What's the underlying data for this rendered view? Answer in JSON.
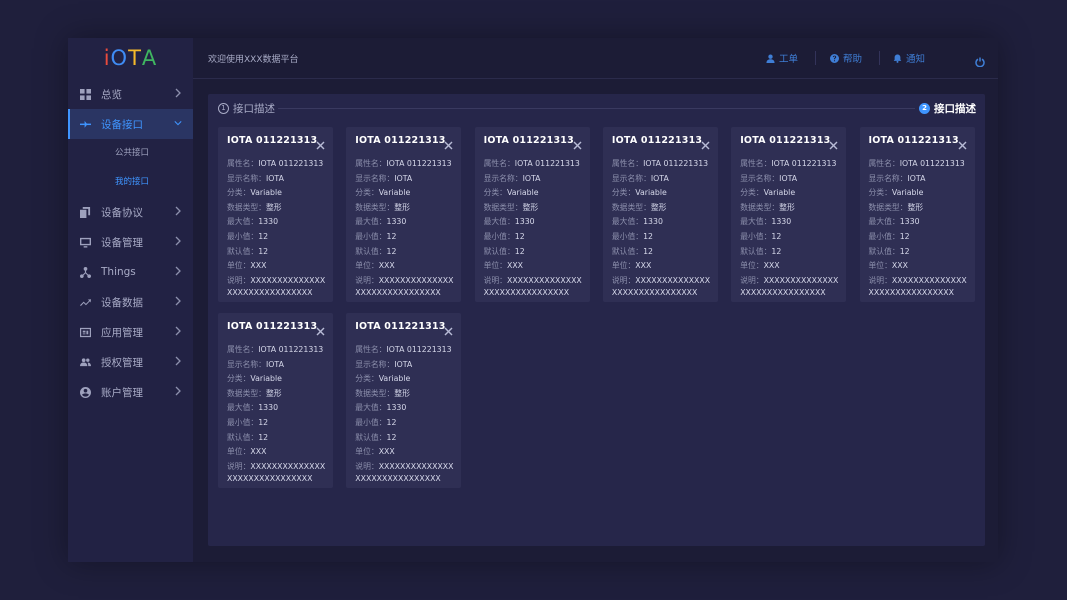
{
  "app": {
    "logo_letters": [
      {
        "ch": "i",
        "color": "#e94b3c"
      },
      {
        "ch": "O",
        "color": "#3f8cf5"
      },
      {
        "ch": "T",
        "color": "#f5b92a"
      },
      {
        "ch": "A",
        "color": "#3fb560"
      }
    ]
  },
  "header": {
    "welcome": "欢迎使用XXX数据平台",
    "worklist": "工单",
    "help": "帮助",
    "notify": "通知"
  },
  "sidebar": {
    "items": [
      {
        "label": "总览",
        "icon": "dashboard-icon"
      },
      {
        "label": "设备接口",
        "icon": "interface-icon",
        "active": true
      },
      {
        "label": "设备协议",
        "icon": "copy-icon"
      },
      {
        "label": "设备管理",
        "icon": "monitor-icon"
      },
      {
        "label": "Things",
        "icon": "network-icon"
      },
      {
        "label": "设备数据",
        "icon": "trend-icon"
      },
      {
        "label": "应用管理",
        "icon": "app-icon"
      },
      {
        "label": "授权管理",
        "icon": "people-icon"
      },
      {
        "label": "账户管理",
        "icon": "account-icon"
      }
    ],
    "submenu": [
      {
        "label": "公共接口"
      },
      {
        "label": "我的接口",
        "active": true
      }
    ]
  },
  "steps": {
    "step1": {
      "num": "1",
      "label": "接口描述"
    },
    "step2": {
      "num": "2",
      "label": "接口描述"
    }
  },
  "labels": {
    "attr_name": "属性名：",
    "display_name": "显示名称：",
    "category": "分类：",
    "data_type": "数据类型：",
    "max": "最大值：",
    "min": "最小值：",
    "default": "默认值：",
    "unit": "单位：",
    "desc": "说明："
  },
  "cards": [
    {
      "title": "IOTA  011221313",
      "attr_name": "IOTA  011221313",
      "display_name": "IOTA",
      "category": "Variable",
      "data_type": "整形",
      "max": "1330",
      "min": "12",
      "default": "12",
      "unit": "XXX",
      "desc": "XXXXXXXXXXXXXXXXXXXXXXXXXXXXXX"
    },
    {
      "title": "IOTA  011221313",
      "attr_name": "IOTA  011221313",
      "display_name": "IOTA",
      "category": "Variable",
      "data_type": "整形",
      "max": "1330",
      "min": "12",
      "default": "12",
      "unit": "XXX",
      "desc": "XXXXXXXXXXXXXXXXXXXXXXXXXXXXXX"
    },
    {
      "title": "IOTA  011221313",
      "attr_name": "IOTA  011221313",
      "display_name": "IOTA",
      "category": "Variable",
      "data_type": "整形",
      "max": "1330",
      "min": "12",
      "default": "12",
      "unit": "XXX",
      "desc": "XXXXXXXXXXXXXXXXXXXXXXXXXXXXXX"
    },
    {
      "title": "IOTA  011221313",
      "attr_name": "IOTA  011221313",
      "display_name": "IOTA",
      "category": "Variable",
      "data_type": "整形",
      "max": "1330",
      "min": "12",
      "default": "12",
      "unit": "XXX",
      "desc": "XXXXXXXXXXXXXXXXXXXXXXXXXXXXXX"
    },
    {
      "title": "IOTA  011221313",
      "attr_name": "IOTA  011221313",
      "display_name": "IOTA",
      "category": "Variable",
      "data_type": "整形",
      "max": "1330",
      "min": "12",
      "default": "12",
      "unit": "XXX",
      "desc": "XXXXXXXXXXXXXXXXXXXXXXXXXXXXXX"
    },
    {
      "title": "IOTA  011221313",
      "attr_name": "IOTA  011221313",
      "display_name": "IOTA",
      "category": "Variable",
      "data_type": "整形",
      "max": "1330",
      "min": "12",
      "default": "12",
      "unit": "XXX",
      "desc": "XXXXXXXXXXXXXXXXXXXXXXXXXXXXXX"
    },
    {
      "title": "IOTA  011221313",
      "attr_name": "IOTA  011221313",
      "display_name": "IOTA",
      "category": "Variable",
      "data_type": "整形",
      "max": "1330",
      "min": "12",
      "default": "12",
      "unit": "XXX",
      "desc": "XXXXXXXXXXXXXXXXXXXXXXXXXXXXXX"
    },
    {
      "title": "IOTA  011221313",
      "attr_name": "IOTA  011221313",
      "display_name": "IOTA",
      "category": "Variable",
      "data_type": "整形",
      "max": "1330",
      "min": "12",
      "default": "12",
      "unit": "XXX",
      "desc": "XXXXXXXXXXXXXXXXXXXXXXXXXXXXXX"
    }
  ],
  "colors": {
    "accent": "#3f95ff",
    "background": "#1f1f3c",
    "panel": "#26264a",
    "card": "#2f2f54"
  }
}
